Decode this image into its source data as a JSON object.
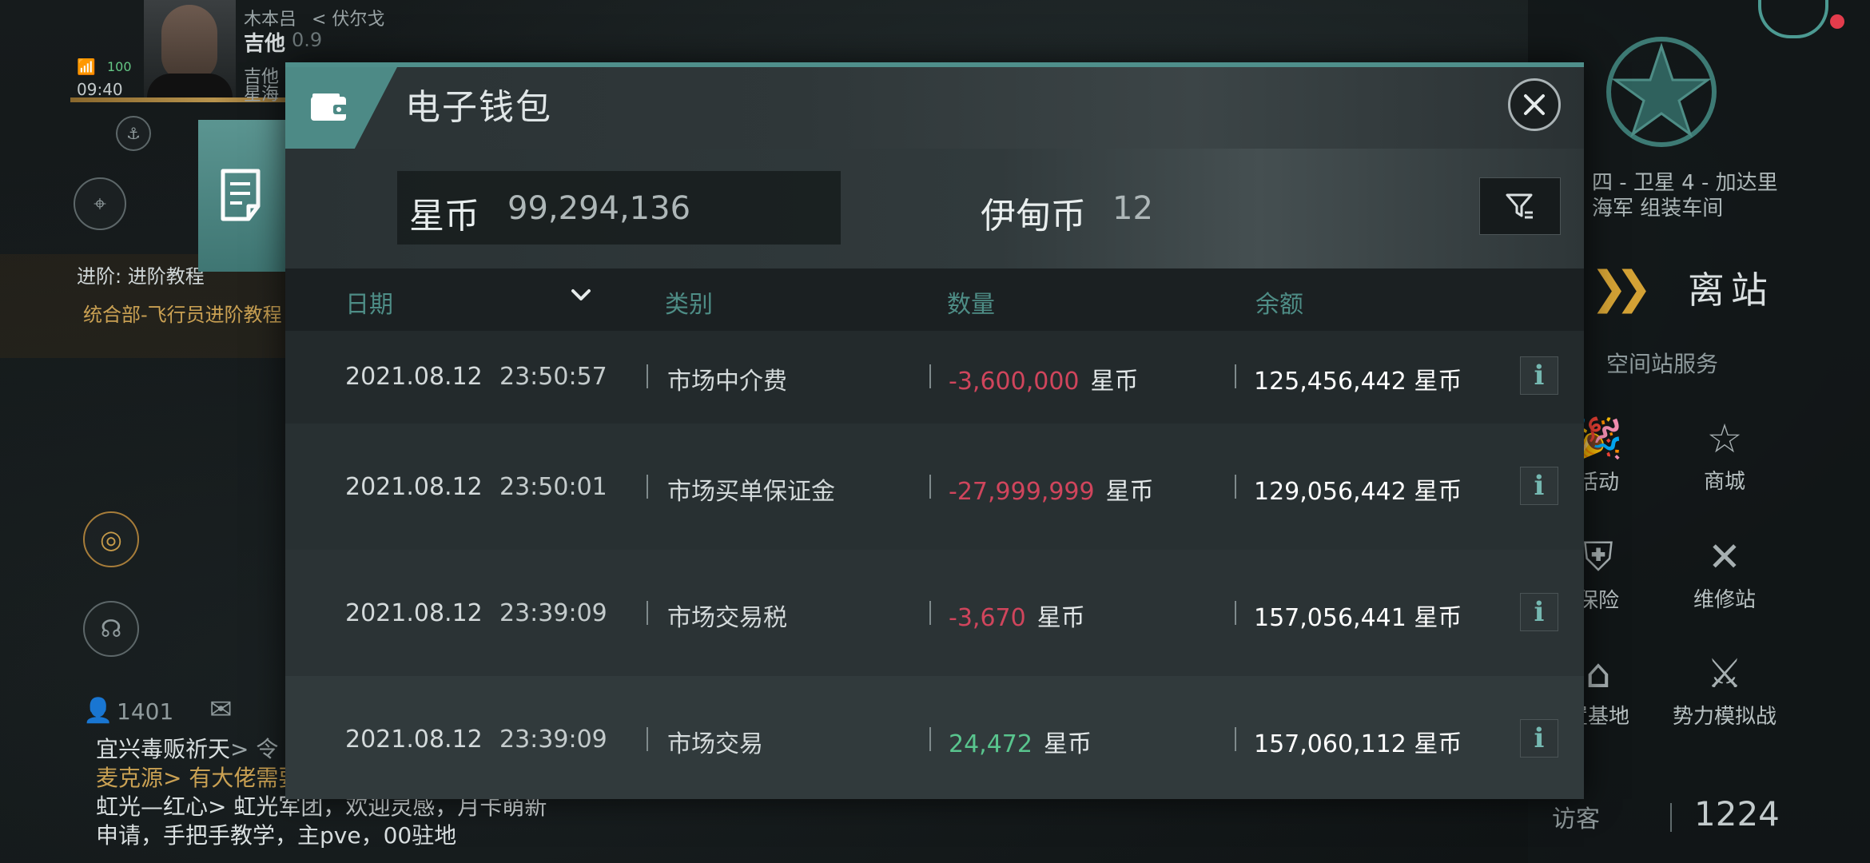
{
  "hud": {
    "player_name_small": "木本吕",
    "location_back": "< 伏尔戈",
    "player_name": "吉他",
    "security": "0.9",
    "corp_line1": "吉他",
    "corp_line2": "星海",
    "clock": "09:40",
    "battery": "100",
    "task_title": "进阶: 进阶教程",
    "task_subtitle": "统合部-飞行员进阶教程",
    "contacts_count": "1401",
    "chat_lines": [
      {
        "name": "宜兴毒贩祈天",
        "msg": "> 令"
      },
      {
        "name": "麦克源",
        "msg": "> 有大佬需要"
      },
      {
        "name": "虹光—红心",
        "msg": "> 虹光军团，欢迎灵感，月卡萌新"
      },
      {
        "name": "",
        "msg": "申请，手把手教学，主pve，00驻地"
      }
    ]
  },
  "station": {
    "location_line1": "四 - 卫星 4 - 加达里",
    "location_line2": "海军 组装车间",
    "depart_label": "离站",
    "services_title": "空间站服务",
    "services": [
      {
        "label": "活动",
        "icon": "party-popper-icon"
      },
      {
        "label": "商城",
        "icon": "star-shop-icon"
      },
      {
        "label": "保险",
        "icon": "shield-icon"
      },
      {
        "label": "维修站",
        "icon": "wrench-icon"
      },
      {
        "label": "置基地",
        "icon": "base-icon"
      },
      {
        "label": "势力模拟战",
        "icon": "crossed-flags-icon"
      }
    ],
    "visitor_label": "访客",
    "visitor_count": "1224"
  },
  "wallet": {
    "title": "电子钱包",
    "currency1_label": "星币",
    "currency1_value": "99,294,136",
    "currency2_label": "伊甸币",
    "currency2_value": "12",
    "columns": {
      "date": "日期",
      "category": "类别",
      "amount": "数量",
      "balance": "余额"
    },
    "rows": [
      {
        "date": "2021.08.12",
        "time": "23:50:57",
        "category": "市场中介费",
        "amount": "-3,600,000",
        "amount_unit": "星币",
        "balance": "125,456,442 星币",
        "sign": "neg"
      },
      {
        "date": "2021.08.12",
        "time": "23:50:01",
        "category": "市场买单保证金",
        "amount": "-27,999,999",
        "amount_unit": "星币",
        "balance": "129,056,442 星币",
        "sign": "neg"
      },
      {
        "date": "2021.08.12",
        "time": "23:39:09",
        "category": "市场交易税",
        "amount": "-3,670",
        "amount_unit": "星币",
        "balance": "157,056,441 星币",
        "sign": "neg"
      },
      {
        "date": "2021.08.12",
        "time": "23:39:09",
        "category": "市场交易",
        "amount": "24,472",
        "amount_unit": "星币",
        "balance": "157,060,112 星币",
        "sign": "pos"
      }
    ],
    "info_glyph": "i",
    "colors": {
      "accent": "#4f8f8b",
      "negative": "#d0455c",
      "positive": "#59c58e",
      "header_text": "#4e8d86"
    }
  }
}
